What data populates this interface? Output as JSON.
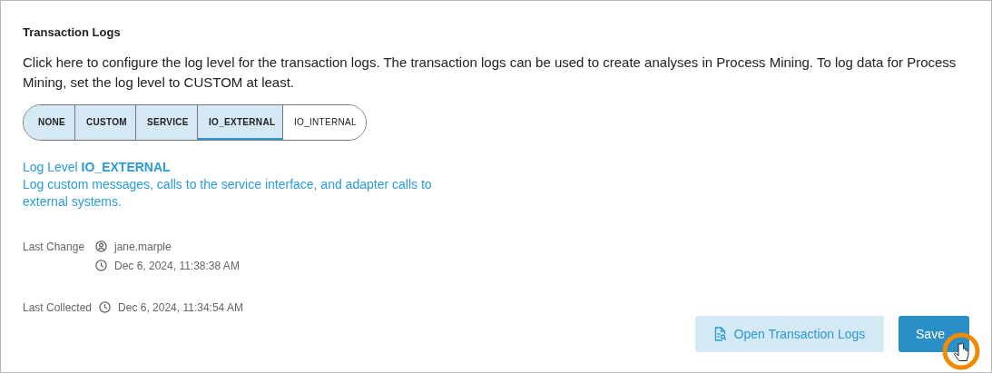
{
  "title": "Transaction Logs",
  "description": "Click here to configure the log level for the transaction logs. The transaction logs can be used to create analyses in Process Mining. To log data for Process Mining, set the log level to CUSTOM at least.",
  "log_levels": [
    {
      "label": "NONE",
      "selected": false
    },
    {
      "label": "CUSTOM",
      "selected": false
    },
    {
      "label": "SERVICE",
      "selected": false
    },
    {
      "label": "IO_EXTERNAL",
      "selected": true
    },
    {
      "label": "IO_INTERNAL",
      "selected": false
    }
  ],
  "level_heading": "Log Level **IO_EXTERNAL**",
  "level_description": "Log custom messages, calls to the service interface, and adapter calls to external systems.",
  "last_change": {
    "label": "Last Change",
    "user": "jane.marple",
    "time": "Dec 6, 2024, 11:38:38 AM"
  },
  "last_collected": {
    "label": "Last Collected",
    "time": "Dec 6, 2024, 11:34:54 AM"
  },
  "buttons": [
    {
      "kind": "secondary",
      "label": "Open Transaction Logs"
    },
    {
      "kind": "primary",
      "label": "Save"
    }
  ]
}
